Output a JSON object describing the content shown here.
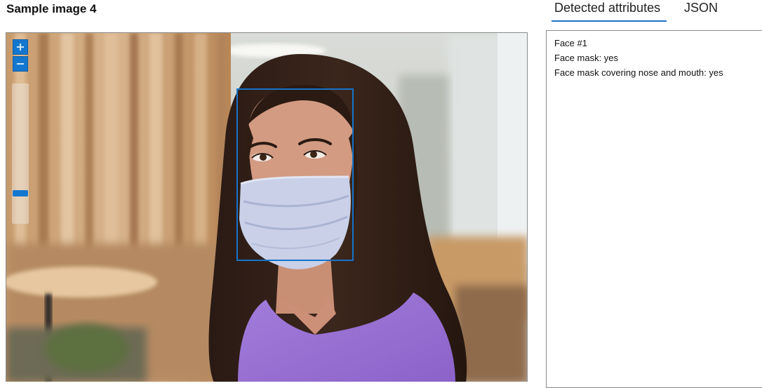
{
  "header": {
    "title": "Sample image 4"
  },
  "tabs": [
    {
      "label": "Detected attributes",
      "selected": true
    },
    {
      "label": "JSON",
      "selected": false
    }
  ],
  "viewer": {
    "zoom_in_icon": "plus-icon",
    "zoom_out_icon": "minus-icon",
    "zoom_level": 0.1,
    "accent_color": "#1477cf"
  },
  "attributes": {
    "lines": [
      "Face #1",
      "Face mask: yes",
      "Face mask covering nose and mouth: yes"
    ]
  }
}
